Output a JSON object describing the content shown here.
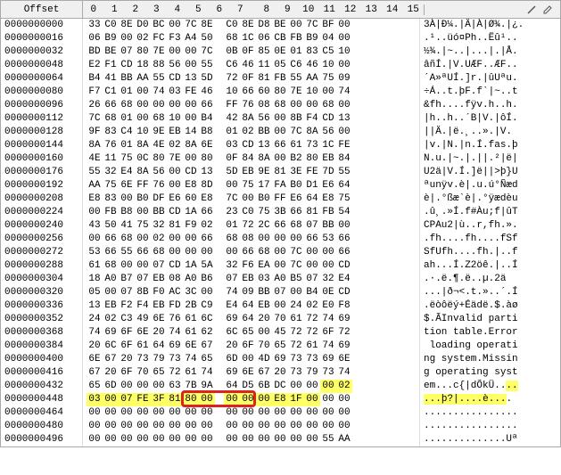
{
  "header": {
    "offset_label": "Offset",
    "columns": [
      "0",
      "1",
      "2",
      "3",
      "4",
      "5",
      "6",
      "7",
      "8",
      "9",
      "10",
      "11",
      "12",
      "13",
      "14",
      "15"
    ],
    "icons": [
      "divider-icon",
      "pencil-icon"
    ]
  },
  "rows": [
    {
      "offset": "0000000000",
      "hex": [
        "33",
        "C0",
        "8E",
        "D0",
        "BC",
        "00",
        "7C",
        "8E",
        "C0",
        "8E",
        "D8",
        "BE",
        "00",
        "7C",
        "BF",
        "00"
      ],
      "ascii": "3À|Ð¼.|Ä|À|Ø¾.|¿."
    },
    {
      "offset": "0000000016",
      "hex": [
        "06",
        "B9",
        "00",
        "02",
        "FC",
        "F3",
        "A4",
        "50",
        "68",
        "1C",
        "06",
        "CB",
        "FB",
        "B9",
        "04",
        "00"
      ],
      "ascii": ".¹..üó¤Ph..Ëû¹.."
    },
    {
      "offset": "0000000032",
      "hex": [
        "BD",
        "BE",
        "07",
        "80",
        "7E",
        "00",
        "00",
        "7C",
        "0B",
        "0F",
        "85",
        "0E",
        "01",
        "83",
        "C5",
        "10"
      ],
      "ascii": "½¾.|~..|...|.|Å."
    },
    {
      "offset": "0000000048",
      "hex": [
        "E2",
        "F1",
        "CD",
        "18",
        "88",
        "56",
        "00",
        "55",
        "C6",
        "46",
        "11",
        "05",
        "C6",
        "46",
        "10",
        "00"
      ],
      "ascii": "âñÍ.|V.UÆF..ÆF.."
    },
    {
      "offset": "0000000064",
      "hex": [
        "B4",
        "41",
        "BB",
        "AA",
        "55",
        "CD",
        "13",
        "5D",
        "72",
        "0F",
        "81",
        "FB",
        "55",
        "AA",
        "75",
        "09"
      ],
      "ascii": "´A»ªUÍ.]r.|ûUªu."
    },
    {
      "offset": "0000000080",
      "hex": [
        "F7",
        "C1",
        "01",
        "00",
        "74",
        "03",
        "FE",
        "46",
        "10",
        "66",
        "60",
        "80",
        "7E",
        "10",
        "00",
        "74"
      ],
      "ascii": "÷Á..t.þF.f`|~..t"
    },
    {
      "offset": "0000000096",
      "hex": [
        "26",
        "66",
        "68",
        "00",
        "00",
        "00",
        "00",
        "66",
        "FF",
        "76",
        "08",
        "68",
        "00",
        "00",
        "68",
        "00"
      ],
      "ascii": "&fh....fÿv.h..h."
    },
    {
      "offset": "0000000112",
      "hex": [
        "7C",
        "68",
        "01",
        "00",
        "68",
        "10",
        "00",
        "B4",
        "42",
        "8A",
        "56",
        "00",
        "8B",
        "F4",
        "CD",
        "13"
      ],
      "ascii": "|h..h..´B|V.|ôÍ."
    },
    {
      "offset": "0000000128",
      "hex": [
        "9F",
        "83",
        "C4",
        "10",
        "9E",
        "EB",
        "14",
        "B8",
        "01",
        "02",
        "BB",
        "00",
        "7C",
        "8A",
        "56",
        "00"
      ],
      "ascii": "||Ä.|ë.¸..».|V."
    },
    {
      "offset": "0000000144",
      "hex": [
        "8A",
        "76",
        "01",
        "8A",
        "4E",
        "02",
        "8A",
        "6E",
        "03",
        "CD",
        "13",
        "66",
        "61",
        "73",
        "1C",
        "FE"
      ],
      "ascii": "|v.|N.|n.Í.fas.þ"
    },
    {
      "offset": "0000000160",
      "hex": [
        "4E",
        "11",
        "75",
        "0C",
        "80",
        "7E",
        "00",
        "80",
        "0F",
        "84",
        "8A",
        "00",
        "B2",
        "80",
        "EB",
        "84"
      ],
      "ascii": "N.u.|~.|.||.²|ë|"
    },
    {
      "offset": "0000000176",
      "hex": [
        "55",
        "32",
        "E4",
        "8A",
        "56",
        "00",
        "CD",
        "13",
        "5D",
        "EB",
        "9E",
        "81",
        "3E",
        "FE",
        "7D",
        "55"
      ],
      "ascii": "U2ä|V.Í.]ë||>þ}U"
    },
    {
      "offset": "0000000192",
      "hex": [
        "AA",
        "75",
        "6E",
        "FF",
        "76",
        "00",
        "E8",
        "8D",
        "00",
        "75",
        "17",
        "FA",
        "B0",
        "D1",
        "E6",
        "64"
      ],
      "ascii": "ªunÿv.è|.u.ú°Ñæd"
    },
    {
      "offset": "0000000208",
      "hex": [
        "E8",
        "83",
        "00",
        "B0",
        "DF",
        "E6",
        "60",
        "E8",
        "7C",
        "00",
        "B0",
        "FF",
        "E6",
        "64",
        "E8",
        "75"
      ],
      "ascii": "è|.°ßæ`è|.°ÿædèu"
    },
    {
      "offset": "0000000224",
      "hex": [
        "00",
        "FB",
        "B8",
        "00",
        "BB",
        "CD",
        "1A",
        "66",
        "23",
        "C0",
        "75",
        "3B",
        "66",
        "81",
        "FB",
        "54"
      ],
      "ascii": ".û¸.»Í.f#Àu;f|ûT"
    },
    {
      "offset": "0000000240",
      "hex": [
        "43",
        "50",
        "41",
        "75",
        "32",
        "81",
        "F9",
        "02",
        "01",
        "72",
        "2C",
        "66",
        "68",
        "07",
        "BB",
        "00"
      ],
      "ascii": "CPAu2|ù..r,fh.»."
    },
    {
      "offset": "0000000256",
      "hex": [
        "00",
        "66",
        "68",
        "00",
        "02",
        "00",
        "00",
        "66",
        "68",
        "08",
        "00",
        "00",
        "00",
        "66",
        "53",
        "66"
      ],
      "ascii": ".fh....fh....fSf"
    },
    {
      "offset": "0000000272",
      "hex": [
        "53",
        "66",
        "55",
        "66",
        "68",
        "00",
        "00",
        "00",
        "00",
        "66",
        "68",
        "00",
        "7C",
        "00",
        "00",
        "66"
      ],
      "ascii": "SfUfh....fh.|..f"
    },
    {
      "offset": "0000000288",
      "hex": [
        "61",
        "68",
        "00",
        "00",
        "07",
        "CD",
        "1A",
        "5A",
        "32",
        "F6",
        "EA",
        "00",
        "7C",
        "00",
        "00",
        "CD"
      ],
      "ascii": "ah...Í.Z2öê.|..Í"
    },
    {
      "offset": "0000000304",
      "hex": [
        "18",
        "A0",
        "B7",
        "07",
        "EB",
        "08",
        "A0",
        "B6",
        "07",
        "EB",
        "03",
        "A0",
        "B5",
        "07",
        "32",
        "E4"
      ],
      "ascii": ".·.ë.¶.ë..µ.2ä"
    },
    {
      "offset": "0000000320",
      "hex": [
        "05",
        "00",
        "07",
        "8B",
        "F0",
        "AC",
        "3C",
        "00",
        "74",
        "09",
        "BB",
        "07",
        "00",
        "B4",
        "0E",
        "CD"
      ],
      "ascii": "...|ð¬<.t.»..´.Í"
    },
    {
      "offset": "0000000336",
      "hex": [
        "13",
        "EB",
        "F2",
        "F4",
        "EB",
        "FD",
        "2B",
        "C9",
        "E4",
        "64",
        "EB",
        "00",
        "24",
        "02",
        "E0",
        "F8"
      ],
      "ascii": ".ëòôëý+Éädë.$.àø"
    },
    {
      "offset": "0000000352",
      "hex": [
        "24",
        "02",
        "C3",
        "49",
        "6E",
        "76",
        "61",
        "6C",
        "69",
        "64",
        "20",
        "70",
        "61",
        "72",
        "74",
        "69"
      ],
      "ascii": "$.ÃInvalid parti"
    },
    {
      "offset": "0000000368",
      "hex": [
        "74",
        "69",
        "6F",
        "6E",
        "20",
        "74",
        "61",
        "62",
        "6C",
        "65",
        "00",
        "45",
        "72",
        "72",
        "6F",
        "72"
      ],
      "ascii": "tion table.Error"
    },
    {
      "offset": "0000000384",
      "hex": [
        "20",
        "6C",
        "6F",
        "61",
        "64",
        "69",
        "6E",
        "67",
        "20",
        "6F",
        "70",
        "65",
        "72",
        "61",
        "74",
        "69"
      ],
      "ascii": " loading operati"
    },
    {
      "offset": "0000000400",
      "hex": [
        "6E",
        "67",
        "20",
        "73",
        "79",
        "73",
        "74",
        "65",
        "6D",
        "00",
        "4D",
        "69",
        "73",
        "73",
        "69",
        "6E"
      ],
      "ascii": "ng system.Missin"
    },
    {
      "offset": "0000000416",
      "hex": [
        "67",
        "20",
        "6F",
        "70",
        "65",
        "72",
        "61",
        "74",
        "69",
        "6E",
        "67",
        "20",
        "73",
        "79",
        "73",
        "74"
      ],
      "ascii": "g operating syst"
    },
    {
      "offset": "0000000432",
      "hex": [
        "65",
        "6D",
        "00",
        "00",
        "00",
        "63",
        "7B",
        "9A",
        "64",
        "D5",
        "6B",
        "DC",
        "00",
        "00",
        "00",
        "02"
      ],
      "ascii": "em...c{|dÕkÜ....",
      "hl_hex": [
        14,
        15
      ],
      "hl_ascii": [
        14,
        15
      ]
    },
    {
      "offset": "0000000448",
      "hex": [
        "03",
        "00",
        "07",
        "FE",
        "3F",
        "81",
        "80",
        "00",
        "00",
        "00",
        "00",
        "E8",
        "1F",
        "00",
        "00",
        "00"
      ],
      "ascii": "...þ?|....è....",
      "hl_hex": [
        0,
        1,
        2,
        3,
        4,
        5,
        6,
        7,
        8,
        9,
        10,
        11,
        12,
        13
      ],
      "hl_ascii": [
        0,
        1,
        2,
        3,
        4,
        5,
        6,
        7,
        8,
        9,
        10,
        11,
        12,
        13
      ],
      "red_box": [
        6,
        9
      ]
    },
    {
      "offset": "0000000464",
      "hex": [
        "00",
        "00",
        "00",
        "00",
        "00",
        "00",
        "00",
        "00",
        "00",
        "00",
        "00",
        "00",
        "00",
        "00",
        "00",
        "00"
      ],
      "ascii": "................"
    },
    {
      "offset": "0000000480",
      "hex": [
        "00",
        "00",
        "00",
        "00",
        "00",
        "00",
        "00",
        "00",
        "00",
        "00",
        "00",
        "00",
        "00",
        "00",
        "00",
        "00"
      ],
      "ascii": "................"
    },
    {
      "offset": "0000000496",
      "hex": [
        "00",
        "00",
        "00",
        "00",
        "00",
        "00",
        "00",
        "00",
        "00",
        "00",
        "00",
        "00",
        "00",
        "00",
        "55",
        "AA"
      ],
      "ascii": "..............Uª"
    }
  ]
}
